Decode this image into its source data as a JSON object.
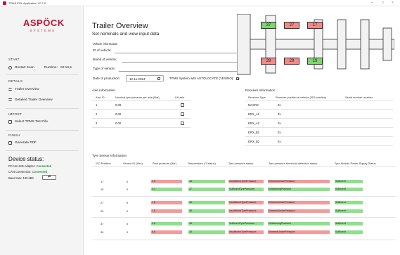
{
  "window": {
    "title": "TPMS EOL Application V0.7.0",
    "minimize": "–",
    "maximize": "□",
    "close": "×"
  },
  "logo": {
    "brand": "ASPÖCK",
    "tagline": "SYSTEMS"
  },
  "sidebar": {
    "start_header": "START",
    "restart_scan": "Restart Scan",
    "runtime_label": "Runtime:",
    "runtime_value": "02:10,5",
    "details_header": "DETAILS",
    "trailer_overview": "Trailer Overview",
    "detailed_trailer_overview": "Detailed Trailer Overview",
    "import_header": "IMPORT",
    "select_tpms_file": "Select TPMS Test File",
    "finish_header": "FINISH",
    "generate_pdf": "Generate PDF"
  },
  "device_status": {
    "title": "Device status:",
    "pcan_label": "PCAN-USB Adapter:",
    "pcan_value": "Connected",
    "can_label": "CAN Connection:",
    "can_value": "Connected",
    "baud_label": "Baud rate: 125 kBit",
    "baud_button": "⇄"
  },
  "main": {
    "title": "Trailer Overview",
    "subtitle": "Set nominals and view input data",
    "vehicle_header": "Vehicle information",
    "id_label": "ID of vehicle:",
    "brand_label": "Brand of vehicle:",
    "type_label": "Type of vehicle:",
    "date_label": "Date of production:",
    "date_value": "12.11.2024",
    "autolocate_label": "TPMS System with AUTOLOCATE (YES/NO):",
    "autolocate_checked": true
  },
  "chassis_badges": [
    {
      "value": "37",
      "color": "green"
    },
    {
      "value": "27",
      "color": "red"
    },
    {
      "value": "17",
      "color": "red"
    },
    {
      "value": "39",
      "color": "red"
    },
    {
      "value": "29",
      "color": "red"
    },
    {
      "value": "19",
      "color": "green"
    }
  ],
  "axle": {
    "header": "Axle information",
    "cols": [
      "Axle ID",
      "Nominal tyre pressure per axle (Bar)",
      "Lift axle"
    ],
    "rows": [
      {
        "id": "1",
        "pressure": "0.00"
      },
      {
        "id": "2",
        "pressure": "0.00"
      },
      {
        "id": "3",
        "pressure": "0.00"
      }
    ]
  },
  "receiver": {
    "header": "Receiver Information",
    "cols": [
      "Receiver Type",
      "Receiver position at vehicle (ISO position)",
      "Serial number receiver"
    ],
    "rows": [
      {
        "type": "MAXRX",
        "pos": "0x"
      },
      {
        "type": "ERX_A1",
        "pos": "0x"
      },
      {
        "type": "ERX_A2",
        "pos": "0x"
      },
      {
        "type": "ERX_B1",
        "pos": "0x"
      },
      {
        "type": "ERX_B2",
        "pos": "0x"
      }
    ]
  },
  "sensors": {
    "header": "Tyre Sensor Information",
    "cols": [
      "ISO Position",
      "Sensor ID (Hex)",
      "Real pressure (Bar)",
      "Temperature (°Celsius)",
      "Tyre pressure status",
      "Tyre pressure threshold detection status",
      "Tyre Module Power Supply Status"
    ],
    "rows": [
      {
        "iso": "17",
        "sid": "0",
        "p": "0,9",
        "pc": "red",
        "t": "33",
        "tc": "green",
        "s": "InsufficientTyrePressure",
        "sc": "red",
        "th": "ExtremeUnderPressure",
        "thc": "red",
        "pw": "Sufficient",
        "pwc": "green"
      },
      {
        "iso": "19",
        "sid": "0",
        "p": "9,2",
        "pc": "green",
        "t": "27",
        "tc": "green",
        "s": "SufficientTyrePressure",
        "sc": "green",
        "th": "NoWarningPressure",
        "thc": "green",
        "pw": "Sufficient",
        "pwc": "green"
      },
      {
        "iso": "27",
        "sid": "0",
        "p": "7,8",
        "pc": "red",
        "t": "34",
        "tc": "green",
        "s": "InsufficientTyrePressure",
        "sc": "red",
        "th": "ExtremeUnderPressure",
        "thc": "red",
        "pw": "Sufficient",
        "pwc": "green"
      },
      {
        "iso": "29",
        "sid": "0",
        "p": "7,5",
        "pc": "red",
        "t": "36",
        "tc": "green",
        "s": "InsufficientTyrePressure",
        "sc": "red",
        "th": "ExtremeUnderPressure",
        "thc": "red",
        "pw": "Sufficient",
        "pwc": "green"
      },
      {
        "iso": "37",
        "sid": "0",
        "p": "9,6",
        "pc": "green",
        "t": "34",
        "tc": "green",
        "s": "SufficientTyrePressure",
        "sc": "green",
        "th": "NoWarningPressure",
        "thc": "green",
        "pw": "Sufficient",
        "pwc": "green"
      },
      {
        "iso": "39",
        "sid": "0",
        "p": "6,8",
        "pc": "red",
        "t": "28",
        "tc": "green",
        "s": "InsufficientTyrePressure",
        "sc": "red",
        "th": "ExtremeUnderPressure",
        "thc": "red",
        "pw": "Sufficient",
        "pwc": "green"
      }
    ]
  }
}
